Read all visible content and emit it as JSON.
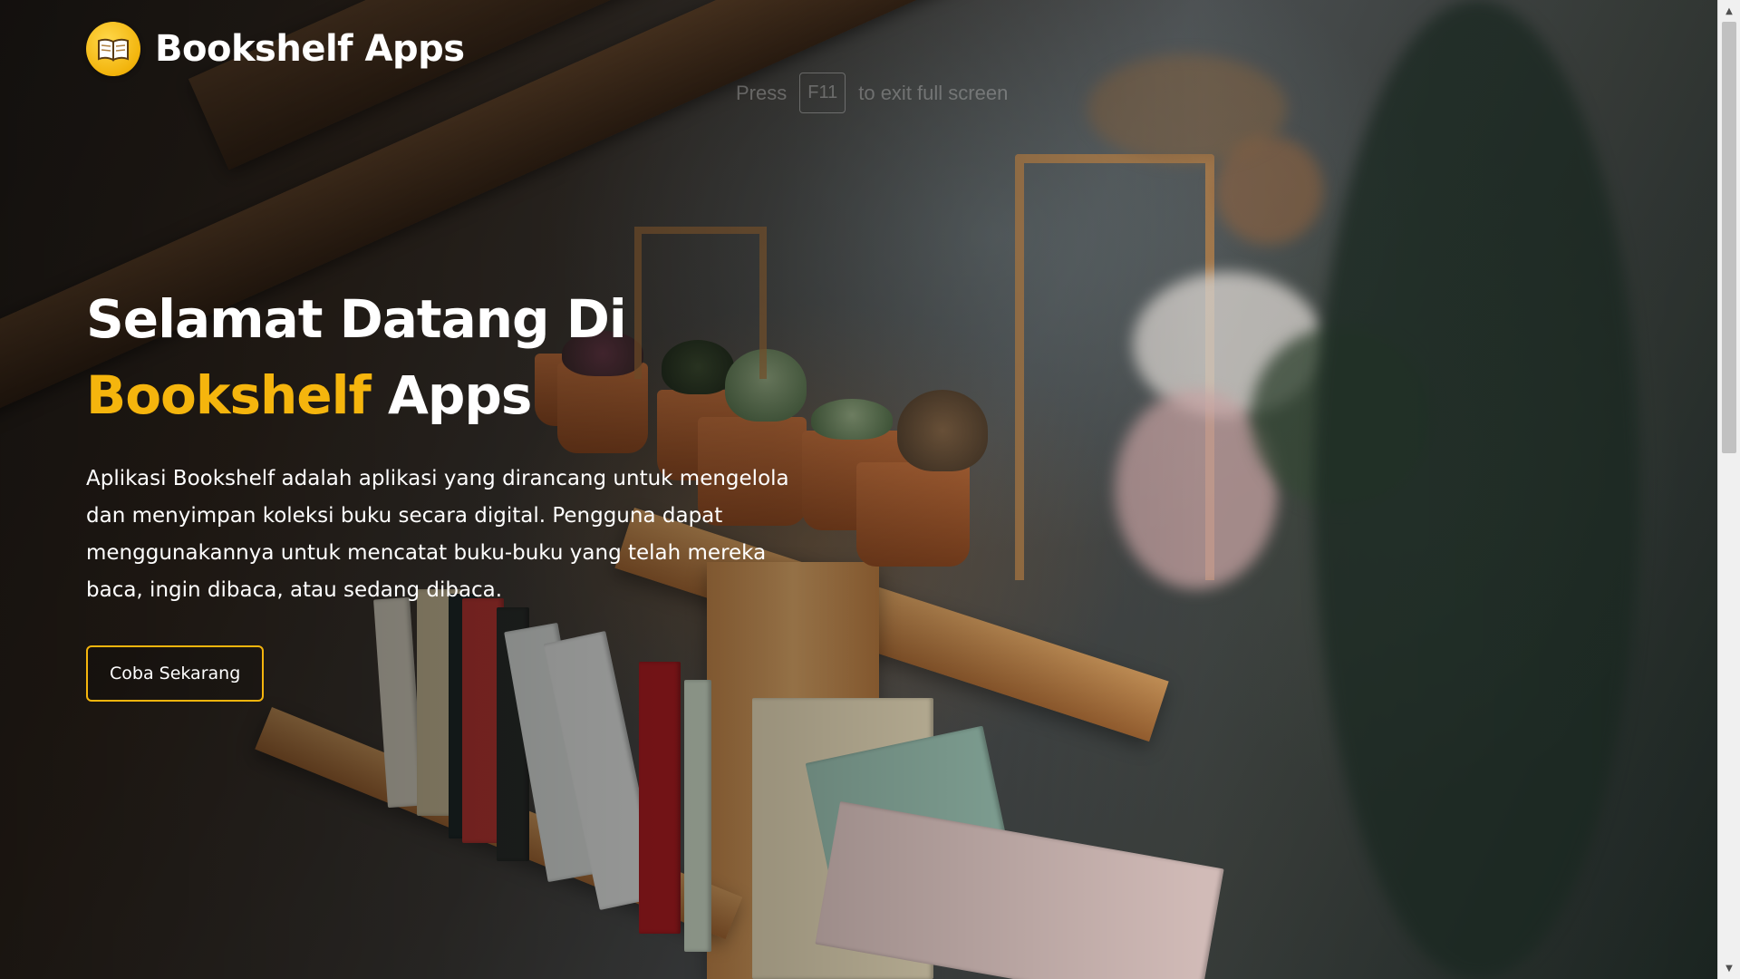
{
  "header": {
    "brand": "Bookshelf Apps",
    "logo_icon": "open-book-icon",
    "accent_color": "#f5b50d"
  },
  "fullscreen_hint": {
    "prefix": "Press",
    "key": "F11",
    "suffix": "to exit full screen"
  },
  "hero": {
    "title_line1": "Selamat Datang Di",
    "title_accent": "Bookshelf",
    "title_rest": "Apps",
    "description": "Aplikasi Bookshelf adalah aplikasi yang dirancang untuk mengelola dan menyimpan koleksi buku secara digital. Pengguna dapat menggunakannya untuk mencatat buku-buku yang telah mereka baca, ingin dibaca, atau sedang dibaca.",
    "cta_label": "Coba Sekarang"
  },
  "scrollbar": {
    "up_icon": "chevron-up-icon",
    "down_icon": "chevron-down-icon"
  }
}
